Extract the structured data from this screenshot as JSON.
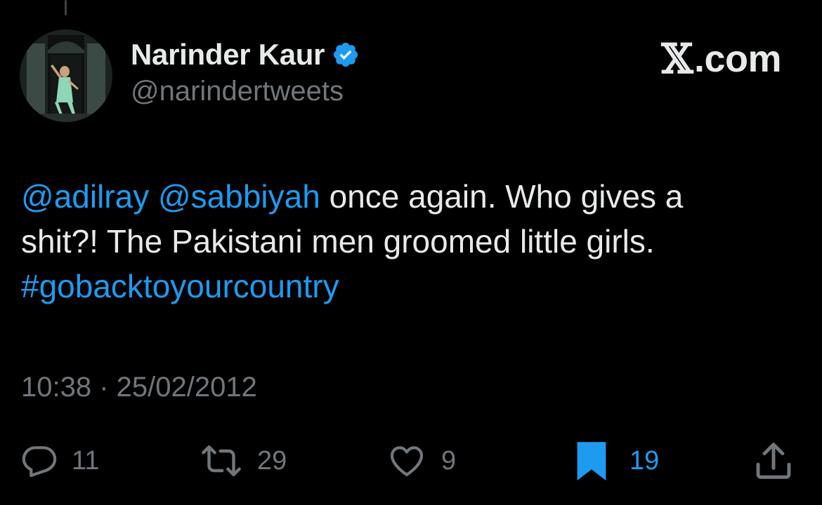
{
  "author": {
    "display_name": "Narinder Kaur",
    "handle": "@narindertweets",
    "verified": true
  },
  "brand": {
    "x_glyph": "𝕏",
    "suffix": ".com"
  },
  "tweet": {
    "line1": {
      "mention1": "@adilray",
      "mention2": "@sabbiyah",
      "text": " once again. Who gives a"
    },
    "line2": "shit?! The Pakistani men groomed little girls.",
    "hashtag": "#gobacktoyourcountry"
  },
  "timestamp": "10:38 · 25/02/2012",
  "actions": {
    "replies": "11",
    "reposts": "29",
    "likes": "9",
    "bookmarks": "19",
    "bookmarked": true
  },
  "colors": {
    "background": "#000000",
    "text": "#e7e9ea",
    "secondary": "#71767b",
    "accent": "#1d9bf0"
  },
  "icons": {
    "reply": "reply-bubble-icon",
    "repost": "repost-arrows-icon",
    "like": "heart-outline-icon",
    "bookmark": "bookmark-filled-icon",
    "share": "share-upload-icon",
    "verified": "verified-badge-icon"
  }
}
